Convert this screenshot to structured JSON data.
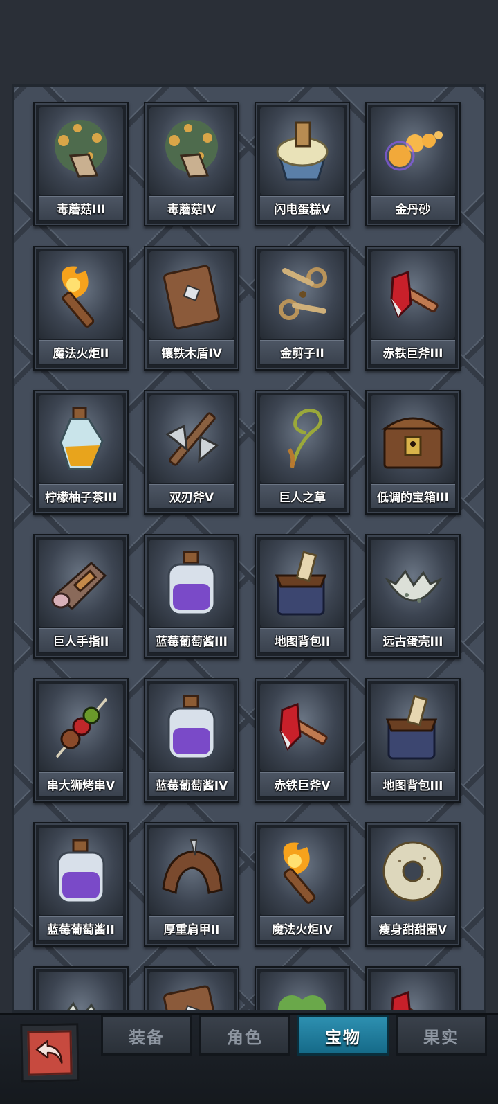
{
  "items": [
    {
      "name": "毒蘑菇III",
      "icon": "mushroom-icon"
    },
    {
      "name": "毒蘑菇IV",
      "icon": "mushroom-icon"
    },
    {
      "name": "闪电蛋糕V",
      "icon": "cupcake-icon"
    },
    {
      "name": "金丹砂",
      "icon": "golden-orbs-icon"
    },
    {
      "name": "魔法火炬II",
      "icon": "torch-icon"
    },
    {
      "name": "镶铁木盾IV",
      "icon": "wooden-shield-icon"
    },
    {
      "name": "金剪子II",
      "icon": "scissors-icon"
    },
    {
      "name": "赤铁巨斧III",
      "icon": "red-axe-icon"
    },
    {
      "name": "柠檬柚子茶III",
      "icon": "potion-bottle-icon"
    },
    {
      "name": "双刃斧V",
      "icon": "double-axe-icon"
    },
    {
      "name": "巨人之草",
      "icon": "herb-icon"
    },
    {
      "name": "低调的宝箱III",
      "icon": "treasure-chest-icon"
    },
    {
      "name": "巨人手指II",
      "icon": "giant-finger-icon"
    },
    {
      "name": "蓝莓葡萄酱III",
      "icon": "jam-jar-icon"
    },
    {
      "name": "地图背包II",
      "icon": "map-bag-icon"
    },
    {
      "name": "远古蛋壳III",
      "icon": "eggshell-icon"
    },
    {
      "name": "串大狮烤串V",
      "icon": "kebab-icon"
    },
    {
      "name": "蓝莓葡萄酱IV",
      "icon": "jam-jar-icon"
    },
    {
      "name": "赤铁巨斧V",
      "icon": "red-axe-icon"
    },
    {
      "name": "地图背包III",
      "icon": "map-bag-icon"
    },
    {
      "name": "蓝莓葡萄酱II",
      "icon": "jam-jar-icon"
    },
    {
      "name": "厚重肩甲II",
      "icon": "pauldron-icon"
    },
    {
      "name": "魔法火炬IV",
      "icon": "torch-icon"
    },
    {
      "name": "瘦身甜甜圈V",
      "icon": "donut-icon"
    },
    {
      "name": "",
      "icon": "eggshell-icon"
    },
    {
      "name": "",
      "icon": "wooden-shield-icon"
    },
    {
      "name": "",
      "icon": "clover-icon"
    },
    {
      "name": "",
      "icon": "red-axe-icon"
    }
  ],
  "tabs": [
    {
      "label": "装备",
      "active": false
    },
    {
      "label": "角色",
      "active": false
    },
    {
      "label": "宝物",
      "active": true
    },
    {
      "label": "果实",
      "active": false
    }
  ],
  "back_button": {
    "icon": "back-arrow-icon"
  },
  "colors": {
    "accent": "#1f7fa0",
    "card_bg": "#1d2229",
    "board_bg": "#444d5b"
  }
}
